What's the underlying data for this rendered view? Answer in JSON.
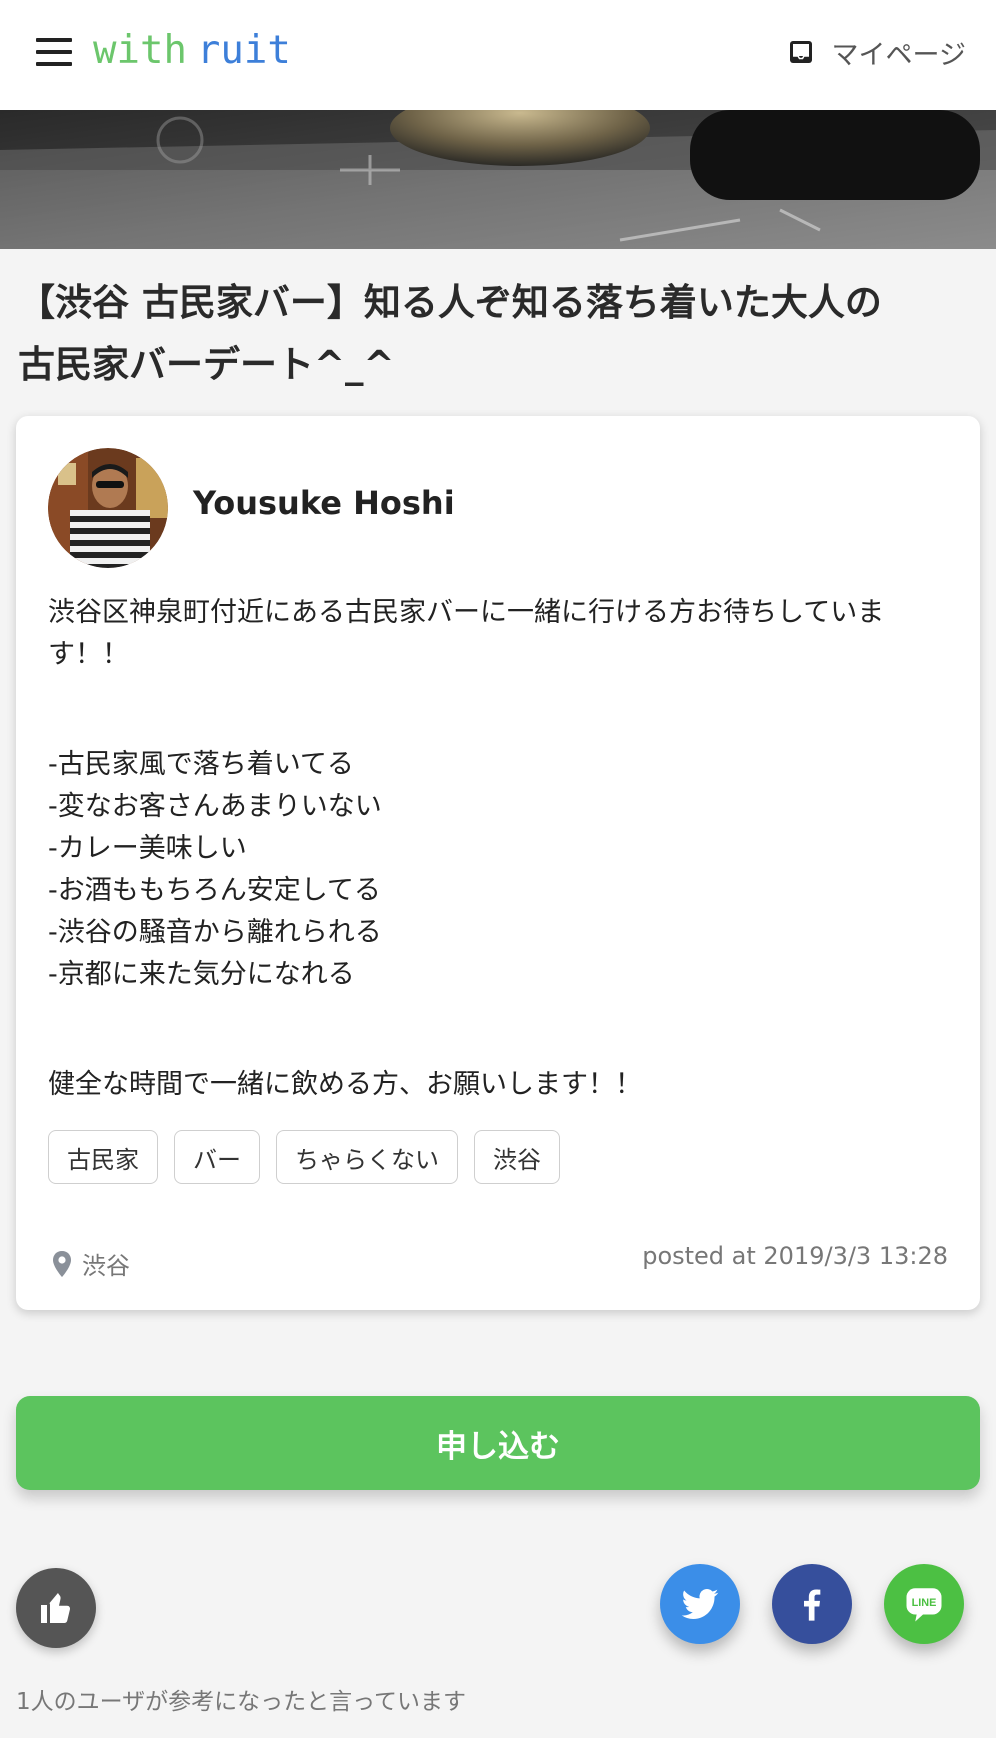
{
  "header": {
    "logo_with": "with",
    "logo_ruit": "ruit",
    "mypage_label": "マイページ"
  },
  "post": {
    "title_line1": "【渋谷 古民家バー】知る人ぞ知る落ち着いた大人の",
    "title_line2": "古民家バーデート^_^",
    "author_name": "Yousuke Hoshi",
    "body": {
      "intro_line1": "渋谷区神泉町付近にある古民家バーに一緒に行ける方お待ちしていま",
      "intro_line2": "す！！",
      "points": [
        "-古民家風で落ち着いてる",
        "-変なお客さんあまりいない",
        "-カレー美味しい",
        "-お酒ももちろん安定してる",
        "-渋谷の騒音から離れられる",
        "-京都に来た気分になれる"
      ],
      "closing": "健全な時間で一緒に飲める方、お願いします！！"
    },
    "tags": [
      "古民家",
      "バー",
      "ちゃらくない",
      "渋谷"
    ],
    "location": "渋谷",
    "posted_at": "posted at 2019/3/3 13:28"
  },
  "actions": {
    "apply_label": "申し込む",
    "likes_text": "1人のユーザが参考になったと言っています"
  },
  "colors": {
    "logo_green": "#6cc66c",
    "logo_blue": "#3d7fd9",
    "apply_green": "#5cc45e",
    "twitter": "#3b8ee8",
    "facebook": "#364f9c",
    "line": "#4cc043",
    "like": "#555555"
  },
  "icons": {
    "menu": "hamburger-menu-icon",
    "mypage": "inbox-icon",
    "location": "map-pin-icon",
    "like": "thumbs-up-icon",
    "share": [
      "twitter-icon",
      "facebook-icon",
      "line-icon"
    ]
  }
}
